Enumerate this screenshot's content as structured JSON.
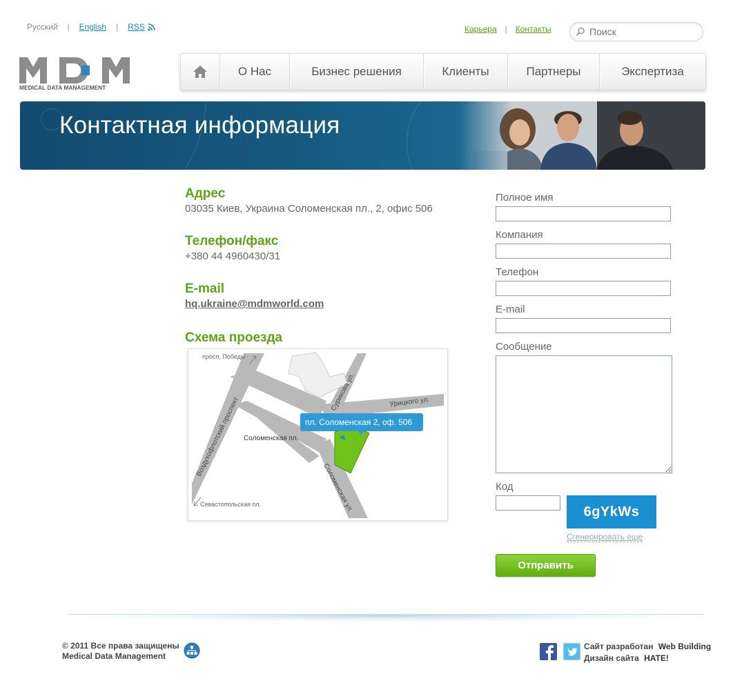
{
  "top_bar": {
    "lang_ru": "Русский",
    "lang_en": "English",
    "rss": "RSS",
    "separator": "|"
  },
  "top_links": {
    "career": "Карьера",
    "contacts": "Контакты",
    "separator": "|"
  },
  "search": {
    "placeholder": "Поиск"
  },
  "logo": {
    "text": "MDM",
    "subtitle": "MEDICAL DATA MANAGEMENT"
  },
  "nav": {
    "home_icon": "home-icon",
    "items": [
      "О Нас",
      "Бизнес решения",
      "Клиенты",
      "Партнеры",
      "Экспертиза"
    ]
  },
  "banner": {
    "title": "Контактная информация"
  },
  "contact": {
    "address_heading": "Адрес",
    "address": "03035 Киев, Украина Соломенская пл., 2, офис 506",
    "phone_heading": "Телефон/факс",
    "phone": "+380 44 4960430/31",
    "email_heading": "E-mail",
    "email": "hq.ukraine@mdmworld.com",
    "map_heading": "Схема проезда"
  },
  "map": {
    "label_pobedy": "просп. Победы",
    "label_surikova": "Сурикова ул.",
    "label_uritskogo": "Урицкого ул.",
    "label_vozduhoflotsky": "Воздухофлотский проспект",
    "label_solomenskaya_sq": "Соломенская пл.",
    "label_solomenskaya_st": "Соломенская ул.",
    "label_sevastopolskaya": "Севастопольская пл.",
    "callout": "пл. Соломенская 2, оф. 506"
  },
  "form": {
    "full_name_label": "Полное имя",
    "company_label": "Компания",
    "phone_label": "Телефон",
    "email_label": "E-mail",
    "message_label": "Сообщение",
    "code_label": "Код",
    "captcha_text": "6gYkWs",
    "regenerate": "Сгенерировать еще",
    "submit": "Отправить"
  },
  "footer": {
    "copyright_line1": "© 2011 Все права защищены",
    "copyright_line2": "Medical Data Management",
    "dev_line1_prefix": "Сайт разработан",
    "dev_line1_brand": "Web Building",
    "dev_line2_prefix": "Дизайн сайта",
    "dev_line2_brand": "HATE!"
  },
  "colors": {
    "accent_green": "#5ea316",
    "link_blue": "#1a8bb8",
    "banner_blue": "#16597f",
    "captcha_blue": "#1a8fd1"
  }
}
